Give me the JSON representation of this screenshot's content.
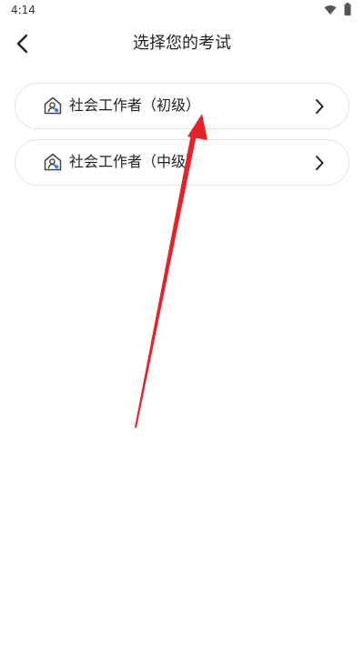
{
  "status_bar": {
    "time": "4:14",
    "icons": [
      "wifi-icon",
      "battery-icon"
    ]
  },
  "header": {
    "back_icon": "back-chevron-icon",
    "title": "选择您的考试"
  },
  "exam_options": [
    {
      "label": "社会工作者（初级）",
      "icon": "house-person-icon",
      "chevron": "chevron-right-icon"
    },
    {
      "label": "社会工作者（中级）",
      "icon": "house-person-icon",
      "chevron": "chevron-right-icon"
    }
  ],
  "annotation": {
    "type": "arrow",
    "color": "#e8202a"
  }
}
